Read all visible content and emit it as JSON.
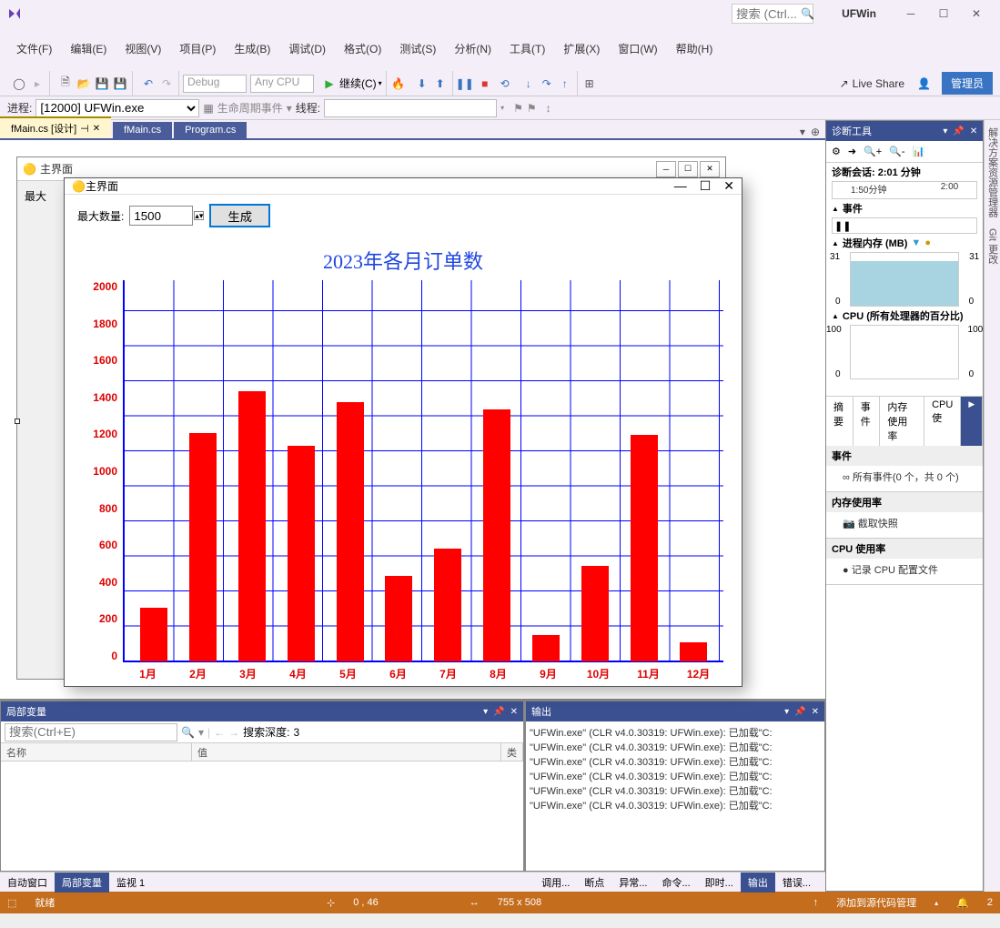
{
  "app_name": "UFWin",
  "search_placeholder": "搜索 (Ctrl...",
  "menus": [
    "文件(F)",
    "编辑(E)",
    "视图(V)",
    "项目(P)",
    "生成(B)",
    "调试(D)",
    "格式(O)",
    "测试(S)",
    "分析(N)",
    "工具(T)",
    "扩展(X)",
    "窗口(W)",
    "帮助(H)"
  ],
  "toolbar": {
    "config": "Debug",
    "platform": "Any CPU",
    "continue": "继续(C)",
    "liveshare": "Live Share",
    "admin": "管理员"
  },
  "process": {
    "label": "进程:",
    "value": "[12000] UFWin.exe",
    "lifecycle": "生命周期事件",
    "thread_label": "线程:"
  },
  "tabs": [
    {
      "label": "fMain.cs [设计]",
      "active": true,
      "pinned": true
    },
    {
      "label": "fMain.cs",
      "active": false
    },
    {
      "label": "Program.cs",
      "active": false
    }
  ],
  "sidebar_labels": [
    "解决方案资源管理器",
    "Git 更改"
  ],
  "form_design_caption": "主界面",
  "form_design_label": "最大",
  "runtime": {
    "caption": "主界面",
    "max_label": "最大数量:",
    "max_value": "1500",
    "gen_button": "生成"
  },
  "chart_data": {
    "type": "bar",
    "title": "2023年各月订单数",
    "categories": [
      "1月",
      "2月",
      "3月",
      "4月",
      "5月",
      "6月",
      "7月",
      "8月",
      "9月",
      "10月",
      "11月",
      "12月"
    ],
    "values": [
      280,
      1200,
      1420,
      1130,
      1360,
      450,
      590,
      1320,
      140,
      500,
      1190,
      100
    ],
    "ymin": 0,
    "ymax": 2000,
    "yticks": [
      0,
      200,
      400,
      600,
      800,
      1000,
      1200,
      1400,
      1600,
      1800,
      2000
    ]
  },
  "diag": {
    "title": "诊断工具",
    "session": "诊断会话: 2:01 分钟",
    "timeline_marks": [
      "1:50分钟",
      "2:00"
    ],
    "events": "事件",
    "mem_label": "进程内存 (MB)",
    "mem_left": "31",
    "mem_right": "31",
    "mem_zero": "0",
    "cpu_label": "CPU (所有处理器的百分比)",
    "cpu_left": "100",
    "cpu_right": "100",
    "cpu_zero": "0",
    "tabs": [
      "摘要",
      "事件",
      "内存使用率",
      "CPU 使"
    ],
    "sec_events": "事件",
    "sec_events_body": "所有事件(0 个，共 0 个)",
    "sec_mem": "内存使用率",
    "sec_mem_body": "截取快照",
    "sec_cpu": "CPU 使用率",
    "sec_cpu_body": "记录 CPU 配置文件"
  },
  "locals": {
    "title": "局部变量",
    "search_placeholder": "搜索(Ctrl+E)",
    "depth_label": "搜索深度:",
    "depth_value": "3",
    "cols": [
      "名称",
      "值",
      "类型"
    ]
  },
  "output": {
    "title": "输出",
    "lines": [
      "\"UFWin.exe\" (CLR v4.0.30319: UFWin.exe): 已加载\"C:",
      "\"UFWin.exe\" (CLR v4.0.30319: UFWin.exe): 已加载\"C:",
      "\"UFWin.exe\" (CLR v4.0.30319: UFWin.exe): 已加载\"C:",
      "\"UFWin.exe\" (CLR v4.0.30319: UFWin.exe): 已加载\"C:",
      "\"UFWin.exe\" (CLR v4.0.30319: UFWin.exe): 已加载\"C:",
      "\"UFWin.exe\" (CLR v4.0.30319: UFWin.exe): 已加载\"C:"
    ]
  },
  "bottom_tabs_left": [
    "自动窗口",
    "局部变量",
    "监视 1"
  ],
  "bottom_tabs_right": [
    "调用...",
    "断点",
    "异常...",
    "命令...",
    "即时...",
    "输出",
    "错误..."
  ],
  "status": {
    "ready": "就绪",
    "pos": "0 , 46",
    "size": "755 x 508",
    "source": "添加到源代码管理",
    "bell": "2"
  }
}
